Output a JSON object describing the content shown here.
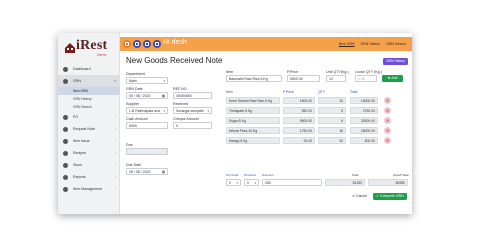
{
  "brand": {
    "name": "iRest",
    "tagline": "Demo"
  },
  "sidebar": {
    "items": [
      {
        "label": "Dashboard",
        "icon": "dashboard-icon"
      },
      {
        "label": "GRN",
        "icon": "grn-icon",
        "active": true,
        "children": [
          {
            "label": "New GRN",
            "selected": true
          },
          {
            "label": "GRN History"
          },
          {
            "label": "GRN Search"
          }
        ]
      },
      {
        "label": "PO",
        "icon": "po-icon"
      },
      {
        "label": "Request Note",
        "icon": "request-note-icon"
      },
      {
        "label": "Item Issue",
        "icon": "item-issue-icon"
      },
      {
        "label": "Recipes",
        "icon": "recipes-icon"
      },
      {
        "label": "Stock",
        "icon": "stock-icon"
      },
      {
        "label": "Reports",
        "icon": "reports-icon"
      },
      {
        "label": "Item Management",
        "icon": "item-management-icon"
      }
    ]
  },
  "topbar": {
    "greeting": "Hi desh",
    "links": [
      "New GRN",
      "GRN History",
      "GRN Search"
    ],
    "color": "#f5a04a"
  },
  "page": {
    "title": "New Goods Received Note",
    "history_button": "GRN History"
  },
  "form": {
    "department": {
      "label": "Department",
      "value": "Main"
    },
    "grn_date": {
      "label": "GRN Date",
      "value": "05 / 08 / 2023"
    },
    "ref_no": {
      "label": "REF NO.",
      "value": "45454545"
    },
    "supplier": {
      "label": "Supplier",
      "value": "L.B Rathnapala and"
    },
    "received": {
      "label": "Received",
      "value": "Suranga sampath"
    },
    "cash_amount": {
      "label": "Cash Amount",
      "value": "5000"
    },
    "cheque_amount": {
      "label": "Cheque Amount",
      "value": "0"
    },
    "due": {
      "label": "Due",
      "value": ""
    },
    "due_date": {
      "label": "Due Date",
      "value": "05 / 08 / 2023"
    }
  },
  "item_entry": {
    "item": {
      "label": "Item",
      "value": "Basmathi Raw Rice,5.Kg"
    },
    "p_price": {
      "label": "P.Price",
      "value": "5500.00"
    },
    "unit_qty": {
      "label": "Unit QTY(Kg.)",
      "value": "12"
    },
    "loose_qty": {
      "label": "Loose QTY (Kg.)",
      "placeholder": "0.00"
    },
    "add_button": "Add"
  },
  "items_table": {
    "headers": [
      "Item",
      "P.Price",
      "QTY",
      "Total"
    ],
    "rows": [
      [
        "Keeri Samba Raw Rice,5.Kg",
        "1500.00",
        "10",
        "15000.00"
      ],
      [
        "Thelapath,5.Kg",
        "550.00",
        "5",
        "2750.00"
      ],
      [
        "Sugar,5.Kg",
        "5500.00",
        "6",
        "33000.00"
      ],
      [
        "Wheat Flour,10.Kg",
        "1750.00",
        "16",
        "28000.00"
      ],
      [
        "Mango,5.Kg",
        "25.00",
        "20",
        "500.00"
      ]
    ]
  },
  "summary": {
    "headers": [
      "Nil Credit",
      "Nil Dueto",
      "Discount",
      "Total",
      "Grand Total"
    ],
    "nil_credit": "0",
    "nil_dueto": "0",
    "discount": "280",
    "total": "81250",
    "grand_total": "80980"
  },
  "actions": {
    "cancel": "Cancel",
    "complete": "Complete GRN"
  }
}
